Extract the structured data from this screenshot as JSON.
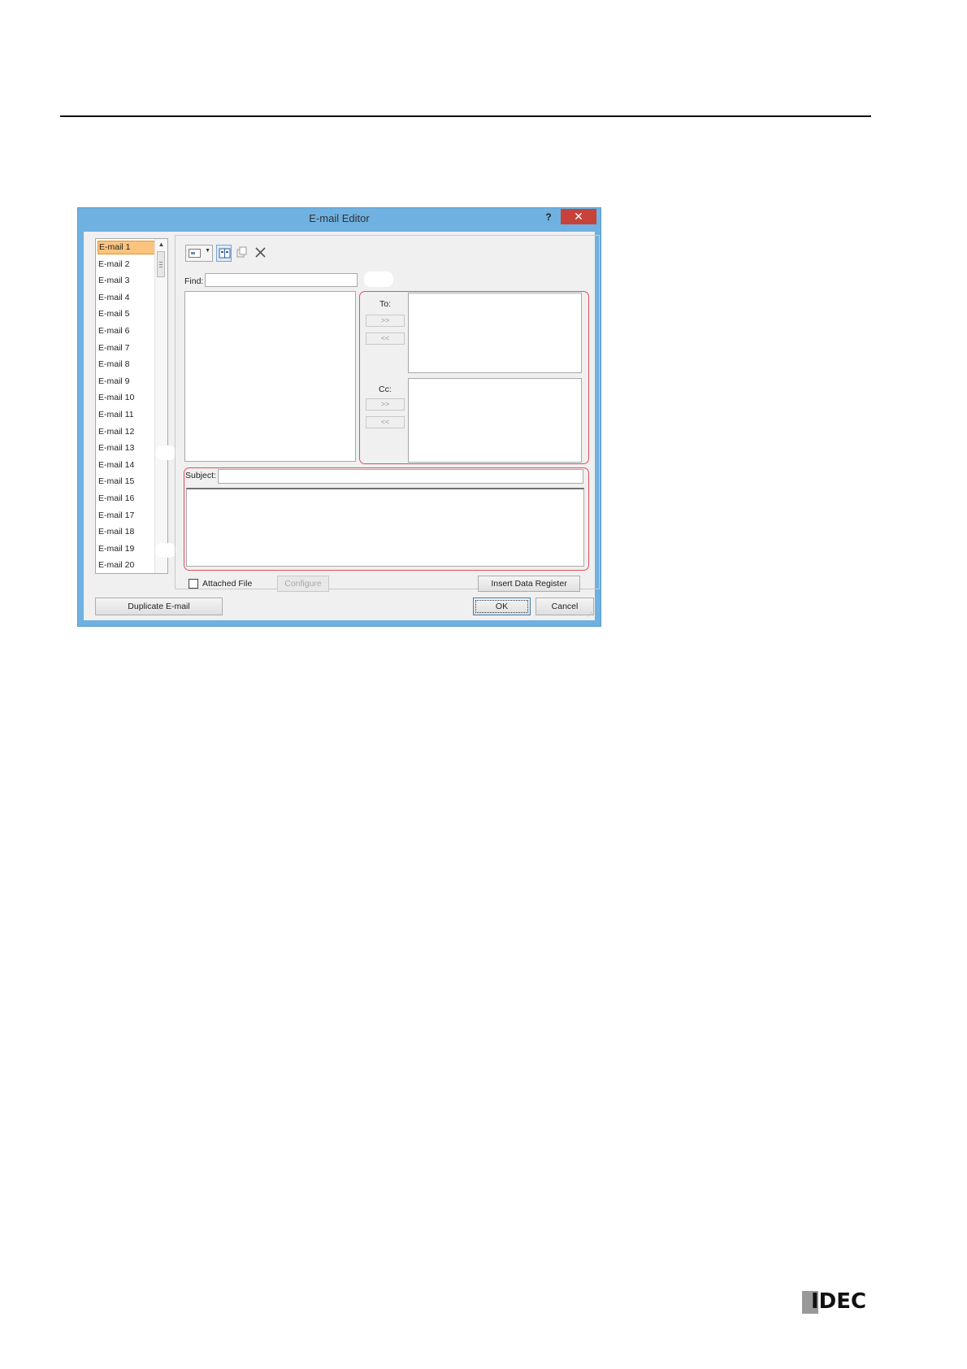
{
  "window": {
    "title": "E-mail Editor",
    "help_glyph": "?",
    "close_glyph": "✕"
  },
  "email_list": {
    "items": [
      "E-mail 1",
      "E-mail 2",
      "E-mail 3",
      "E-mail 4",
      "E-mail 5",
      "E-mail 6",
      "E-mail 7",
      "E-mail 8",
      "E-mail 9",
      "E-mail 10",
      "E-mail 11",
      "E-mail 12",
      "E-mail 13",
      "E-mail 14",
      "E-mail 15",
      "E-mail 16",
      "E-mail 17",
      "E-mail 18",
      "E-mail 19",
      "E-mail 20"
    ],
    "selected_index": 0
  },
  "toolbar": {
    "icons": [
      "address-book-combo-icon",
      "address-book-icon",
      "copy-icon",
      "delete-icon"
    ]
  },
  "find": {
    "label": "Find:",
    "value": ""
  },
  "recipients": {
    "to_label": "To:",
    "cc_label": "Cc:",
    "add_label": ">>",
    "remove_label": "<<"
  },
  "message": {
    "subject_label": "Subject:",
    "subject_value": "",
    "body_value": ""
  },
  "attachment": {
    "checkbox_label": "Attached File",
    "checked": false,
    "configure_label": "Configure"
  },
  "buttons": {
    "insert_data_register": "Insert Data Register",
    "duplicate_email": "Duplicate E-mail",
    "ok": "OK",
    "cancel": "Cancel"
  },
  "brand": {
    "logo_text": "IDEC"
  },
  "colors": {
    "titlebar": "#6fb1e0",
    "close": "#c7423a",
    "selection": "#fbc47e",
    "highlight_box": "#e0505a"
  }
}
